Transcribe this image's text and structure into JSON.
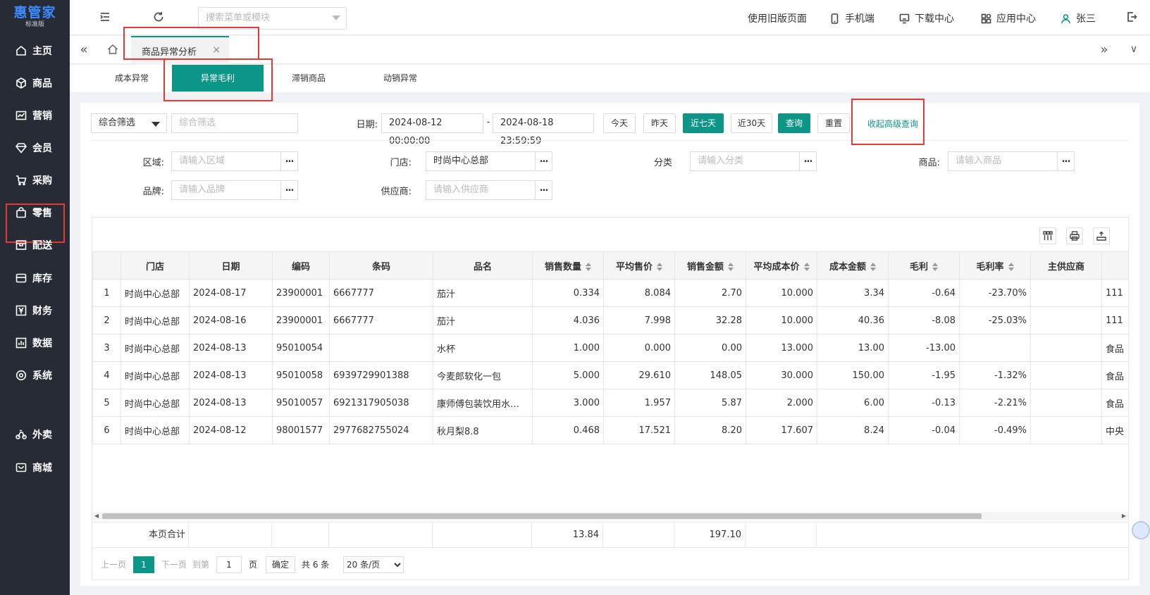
{
  "sidebar": {
    "logo": "惠管家",
    "edition": "标准版",
    "items": [
      {
        "label": "主页",
        "icon": "home-icon"
      },
      {
        "label": "商品",
        "icon": "cube-icon"
      },
      {
        "label": "营销",
        "icon": "chart-icon"
      },
      {
        "label": "会员",
        "icon": "diamond-icon"
      },
      {
        "label": "采购",
        "icon": "cart-icon"
      },
      {
        "label": "零售",
        "icon": "bag-icon"
      },
      {
        "label": "配送",
        "icon": "truck-icon"
      },
      {
        "label": "库存",
        "icon": "box-icon"
      },
      {
        "label": "财务",
        "icon": "yen-icon"
      },
      {
        "label": "数据",
        "icon": "bar-chart-icon"
      },
      {
        "label": "系统",
        "icon": "gear-icon"
      },
      {
        "label": "外卖",
        "icon": "bike-icon"
      },
      {
        "label": "商城",
        "icon": "shop-icon"
      }
    ]
  },
  "topbar": {
    "search_placeholder": "搜索菜单或模块",
    "old_version": "使用旧版页面",
    "mobile": "手机端",
    "download": "下载中心",
    "apps": "应用中心",
    "user": "张三"
  },
  "tabs": {
    "open_tab": "商品异常分析",
    "close": "×"
  },
  "subtabs": [
    "成本异常",
    "异常毛利",
    "滞销商品",
    "动销异常"
  ],
  "filters": {
    "combo_select": "综合筛选",
    "combo_placeholder": "综合筛选",
    "date_label": "日期:",
    "date_start": "2024-08-12 00:00:00",
    "date_sep": "-",
    "date_end": "2024-08-18 23:59:59",
    "btn_today": "今天",
    "btn_yesterday": "昨天",
    "btn_7days": "近七天",
    "btn_30days": "近30天",
    "btn_query": "查询",
    "btn_reset": "重置",
    "collapse": "收起高级查询",
    "region_label": "区域:",
    "region_placeholder": "请输入区域",
    "store_label": "门店:",
    "store_value": "时尚中心总部",
    "category_label": "分类",
    "category_placeholder": "请输入分类",
    "product_label": "商品:",
    "product_placeholder": "请输入商品",
    "brand_label": "品牌:",
    "brand_placeholder": "请输入品牌",
    "supplier_label": "供应商:",
    "supplier_placeholder": "请输入供应商",
    "dots": "..."
  },
  "table": {
    "headers": [
      "",
      "门店",
      "日期",
      "编码",
      "条码",
      "品名",
      "销售数量",
      "平均售价",
      "销售金额",
      "平均成本价",
      "成本金额",
      "毛利",
      "毛利率",
      "主供应商",
      ""
    ],
    "rows": [
      [
        "1",
        "时尚中心总部",
        "2024-08-17",
        "23900001",
        "6667777",
        "茄汁",
        "0.334",
        "8.084",
        "2.70",
        "10.000",
        "3.34",
        "-0.64",
        "-23.70%",
        "",
        "111"
      ],
      [
        "2",
        "时尚中心总部",
        "2024-08-16",
        "23900001",
        "6667777",
        "茄汁",
        "4.036",
        "7.998",
        "32.28",
        "10.000",
        "40.36",
        "-8.08",
        "-25.03%",
        "",
        "111"
      ],
      [
        "3",
        "时尚中心总部",
        "2024-08-13",
        "95010054",
        "",
        "水杯",
        "1.000",
        "0.000",
        "0.00",
        "13.000",
        "13.00",
        "-13.00",
        "",
        "",
        "食品"
      ],
      [
        "4",
        "时尚中心总部",
        "2024-08-13",
        "95010058",
        "6939729901388",
        "今麦郎软化一包",
        "5.000",
        "29.610",
        "148.05",
        "30.000",
        "150.00",
        "-1.95",
        "-1.32%",
        "",
        "食品"
      ],
      [
        "5",
        "时尚中心总部",
        "2024-08-13",
        "95010057",
        "6921317905038",
        "康师傅包装饮用水…",
        "3.000",
        "1.957",
        "5.87",
        "2.000",
        "6.00",
        "-0.13",
        "-2.21%",
        "",
        "食品"
      ],
      [
        "6",
        "时尚中心总部",
        "2024-08-12",
        "98001577",
        "2977682755024",
        "秋月梨8.8",
        "0.468",
        "17.521",
        "8.20",
        "17.607",
        "8.24",
        "-0.04",
        "-0.49%",
        "",
        "中央"
      ]
    ],
    "totals_label": "本页合计",
    "total_qty": "13.84",
    "total_amount": "197.10"
  },
  "pager": {
    "prev": "上一页",
    "current": "1",
    "next": "下一页",
    "goto": "到第",
    "page_input": "1",
    "page_unit": "页",
    "confirm": "确定",
    "total": "共 6 条",
    "page_size": "20 条/页"
  },
  "colors": {
    "accent": "#0b9688",
    "sidebar": "#262b36",
    "highlight": "#e53935"
  }
}
